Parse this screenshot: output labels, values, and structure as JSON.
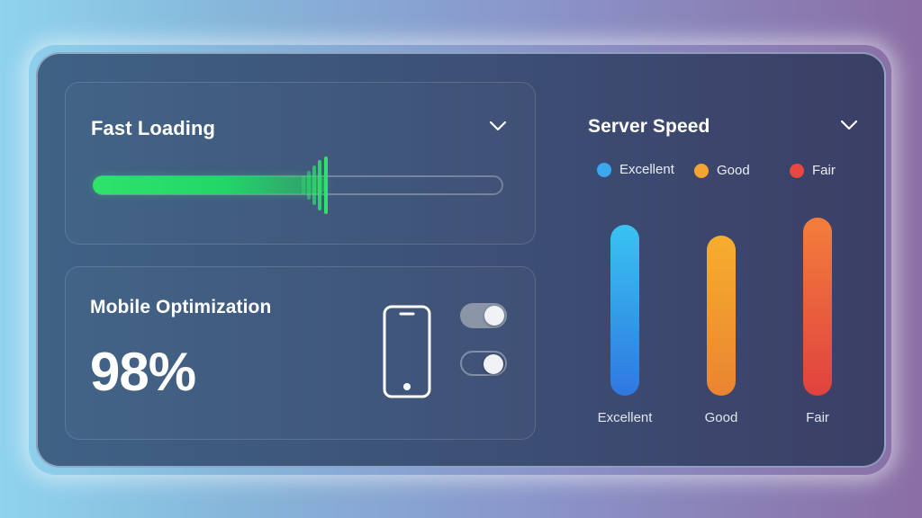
{
  "fast_loading": {
    "title": "Fast Loading",
    "progress": 0.57,
    "color": "#2ee36a"
  },
  "mobile": {
    "title": "Mobile Optimization",
    "value": "98%",
    "toggles": [
      {
        "state": "on"
      },
      {
        "state": "off"
      }
    ]
  },
  "server_speed": {
    "title": "Server Speed",
    "legend": [
      {
        "label": "Excellent",
        "color": "#3aa8ee"
      },
      {
        "label": "Good",
        "color": "#f2a531"
      },
      {
        "label": "Fair",
        "color": "#e8483f"
      }
    ],
    "bars": [
      {
        "label": "Excellent",
        "level": 0.96,
        "top_color": "#39c3f2",
        "bottom_color": "#2f78e0"
      },
      {
        "label": "Good",
        "level": 0.9,
        "top_color": "#f6ae2e",
        "bottom_color": "#ea8431"
      },
      {
        "label": "Fair",
        "level": 1.0,
        "top_color": "#f37e3b",
        "bottom_color": "#e0423f"
      }
    ]
  }
}
